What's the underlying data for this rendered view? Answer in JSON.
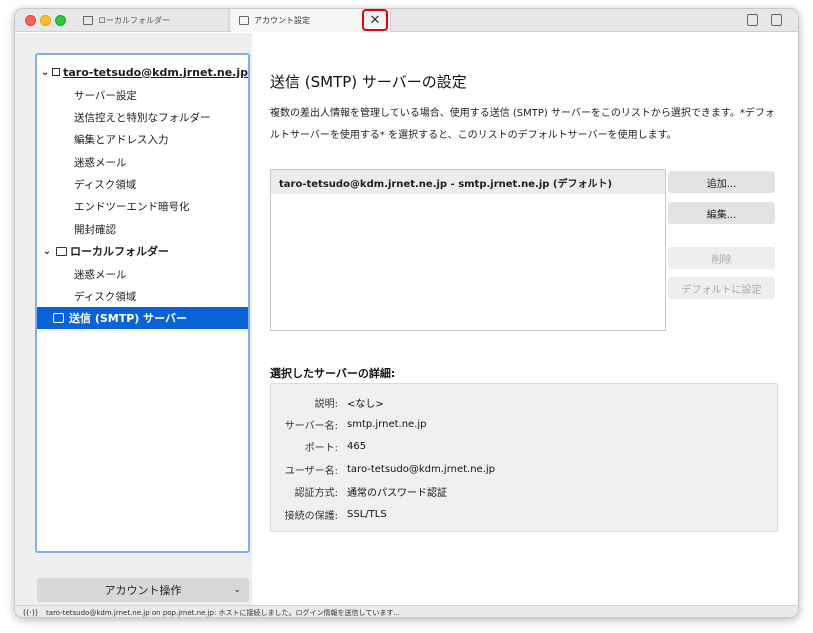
{
  "tabs": [
    {
      "label": "ローカルフォルダー"
    },
    {
      "label": "アカウント設定"
    }
  ],
  "tab_close_glyph": "✕",
  "sidebar": {
    "account": {
      "label": "taro-tetsudo@kdm.jrnet.ne.jp"
    },
    "account_items": [
      {
        "label": "サーバー設定"
      },
      {
        "label": "送信控えと特別なフォルダー"
      },
      {
        "label": "編集とアドレス入力"
      },
      {
        "label": "迷惑メール"
      },
      {
        "label": "ディスク領域"
      },
      {
        "label": "エンドツーエンド暗号化"
      },
      {
        "label": "開封確認"
      }
    ],
    "local": {
      "label": "ローカルフォルダー"
    },
    "local_items": [
      {
        "label": "迷惑メール"
      },
      {
        "label": "ディスク領域"
      }
    ],
    "smtp": {
      "label": "送信 (SMTP) サーバー"
    },
    "account_actions": "アカウント操作"
  },
  "main": {
    "title": "送信 (SMTP) サーバーの設定",
    "description": "複数の差出人情報を管理している場合、使用する送信 (SMTP) サーバーをこのリストから選択できます。*デフォルトサーバーを使用する* を選択すると、このリストのデフォルトサーバーを使用します。",
    "servers": [
      {
        "label": "taro-tetsudo@kdm.jrnet.ne.jp - smtp.jrnet.ne.jp (デフォルト)"
      }
    ],
    "buttons": {
      "add": "追加...",
      "edit": "編集...",
      "delete": "削除",
      "set_default": "デフォルトに設定"
    },
    "details_title": "選択したサーバーの詳細:",
    "details": [
      {
        "label": "説明:",
        "value": "<なし>"
      },
      {
        "label": "サーバー名:",
        "value": "smtp.jrnet.ne.jp"
      },
      {
        "label": "ポート:",
        "value": "465"
      },
      {
        "label": "ユーザー名:",
        "value": "taro-tetsudo@kdm.jrnet.ne.jp"
      },
      {
        "label": "認証方式:",
        "value": "通常のパスワード認証"
      },
      {
        "label": "接続の保護:",
        "value": "SSL/TLS"
      }
    ]
  },
  "status": {
    "text": "taro-tetsudo@kdm.jrnet.ne.jp on pop.jrnet.ne.jp: ホストに接続しました。ログイン情報を送信しています..."
  },
  "colors": {
    "selection": "#0a63d6",
    "highlight_box": "#e60012",
    "focus_border": "#7fb0e8"
  }
}
